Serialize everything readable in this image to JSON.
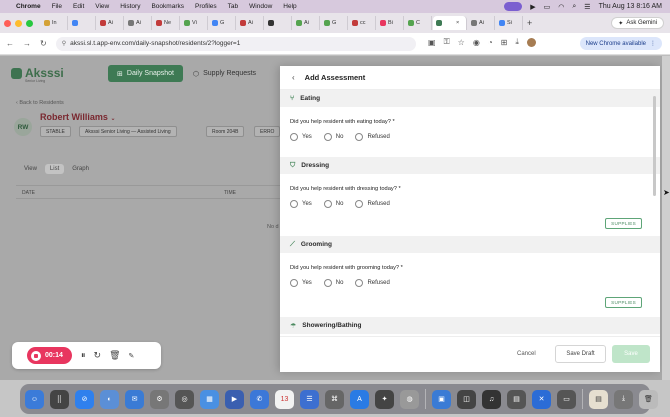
{
  "menubar": {
    "app": "Chrome",
    "items": [
      "File",
      "Edit",
      "View",
      "History",
      "Bookmarks",
      "Profiles",
      "Tab",
      "Window",
      "Help"
    ],
    "clock": "Thu Aug 13  8:16 AM"
  },
  "tabs": [
    {
      "label": "In",
      "color": "#d4a237"
    },
    {
      "label": "",
      "color": "#4285f4"
    },
    {
      "label": "Ai",
      "color": "#c23b3b"
    },
    {
      "label": "Ai",
      "color": "#777777"
    },
    {
      "label": "Ne",
      "color": "#c23b3b"
    },
    {
      "label": "Vi",
      "color": "#55a34f"
    },
    {
      "label": "G",
      "color": "#4285f4"
    },
    {
      "label": "Ai",
      "color": "#c23b3b"
    },
    {
      "label": "",
      "color": "#333333"
    },
    {
      "label": "Ai",
      "color": "#55a34f"
    },
    {
      "label": "G",
      "color": "#55a34f"
    },
    {
      "label": "cc",
      "color": "#c23b3b"
    },
    {
      "label": "Bi",
      "color": "#e8365f"
    },
    {
      "label": "C",
      "color": "#55a34f"
    },
    {
      "label": "",
      "color": "#3e7a54"
    },
    {
      "label": "Ai",
      "color": "#777777"
    },
    {
      "label": "Si",
      "color": "#4285f4"
    }
  ],
  "ask_gemini": "Ask Gemini",
  "address": {
    "url": "akssi.sl.t.app-env.com/daily-snapshot/residents/2?logger=1",
    "new_chrome": "New Chrome available"
  },
  "app": {
    "logo": "Aksssi",
    "logo_sub": "Senior Living",
    "nav_daily": "Daily Snapshot",
    "nav_supply": "Supply Requests",
    "back": "Back to Residents",
    "initials": "RW",
    "resident_name": "Robert Williams",
    "tags": [
      "STABLE",
      "Aksssi Senior Living — Assisted Living",
      "Room 204B",
      "ERRO"
    ],
    "view_label": "View",
    "view_list": "List",
    "view_graph": "Graph",
    "col_date": "DATE",
    "col_time": "TIME",
    "no_data": "No d"
  },
  "recorder": {
    "time": "00:14"
  },
  "modal": {
    "title": "Add Assessment",
    "sections": [
      {
        "name": "Eating",
        "icon": "utensils-icon",
        "question": "Did you help resident with eating today? *",
        "supplies": false
      },
      {
        "name": "Dressing",
        "icon": "shirt-icon",
        "question": "Did you help resident with dressing today? *",
        "supplies": true
      },
      {
        "name": "Grooming",
        "icon": "comb-icon",
        "question": "Did you help resident with grooming today? *",
        "supplies": true
      },
      {
        "name": "Showering/Bathing",
        "icon": "shower-icon",
        "question": "",
        "supplies": false
      }
    ],
    "options": [
      "Yes",
      "No",
      "Refused"
    ],
    "supplies_label": "SUPPLIES",
    "cancel": "Cancel",
    "save_draft": "Save Draft",
    "save": "Save"
  },
  "colors": {
    "brand_green": "#3e7a54",
    "resident_red": "#7a2830",
    "record_pink": "#e8365f",
    "save_disabled": "#bfe5c9"
  }
}
